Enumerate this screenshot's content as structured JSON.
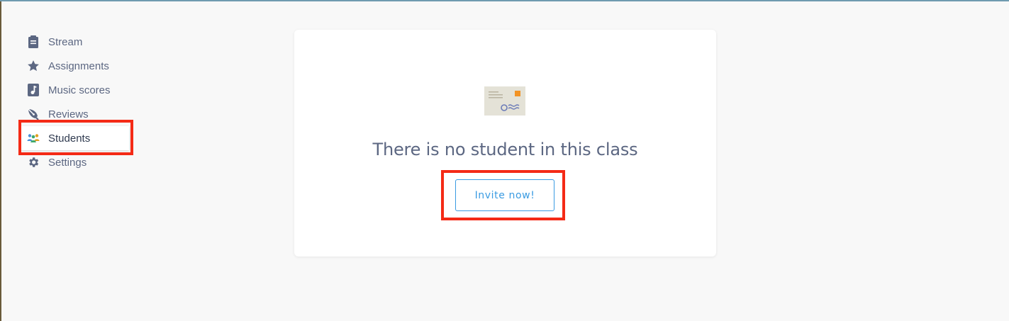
{
  "sidebar": {
    "items": [
      {
        "label": "Stream",
        "icon": "clipboard-icon"
      },
      {
        "label": "Assignments",
        "icon": "star-icon"
      },
      {
        "label": "Music scores",
        "icon": "music-note-icon"
      },
      {
        "label": "Reviews",
        "icon": "pen-nib-icon"
      },
      {
        "label": "Students",
        "icon": "users-icon",
        "active": true
      },
      {
        "label": "Settings",
        "icon": "gear-icon"
      }
    ]
  },
  "main": {
    "empty_state": {
      "illustration": "envelope-icon",
      "message": "There is no student in this class",
      "button_label": "Invite now!"
    }
  },
  "colors": {
    "text": "#5c6782",
    "accent": "#3a9be2",
    "highlight": "#f42a16",
    "background": "#f8f8f8"
  }
}
